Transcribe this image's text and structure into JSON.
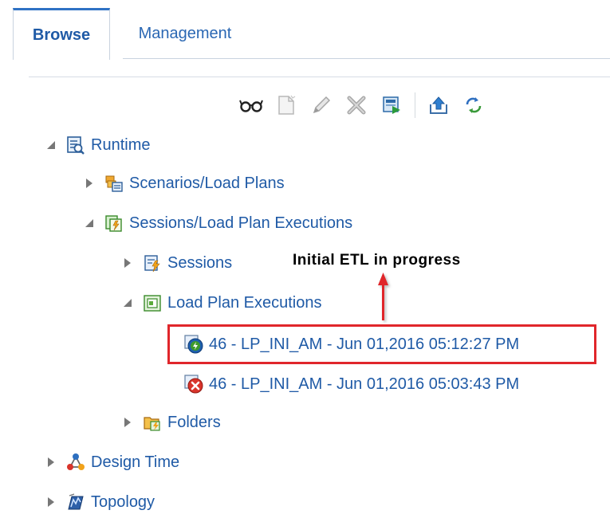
{
  "tabs": {
    "browse": "Browse",
    "management": "Management"
  },
  "toolbar": {
    "icons": [
      "view-icon",
      "new-icon",
      "edit-icon",
      "delete-icon",
      "run-icon",
      "export-icon",
      "refresh-icon"
    ]
  },
  "tree": {
    "runtime": "Runtime",
    "scenarios": "Scenarios/Load Plans",
    "sessions_lpe": "Sessions/Load Plan Executions",
    "sessions": "Sessions",
    "load_plan_executions": "Load Plan Executions",
    "exec_running": "46 - LP_INI_AM - Jun 01,2016 05:12:27 PM",
    "exec_error": "46 - LP_INI_AM - Jun 01,2016 05:03:43 PM",
    "folders": "Folders",
    "design_time": "Design Time",
    "topology": "Topology"
  },
  "annotation": {
    "text": "Initial ETL in progress"
  },
  "colors": {
    "link": "#1f5aa6",
    "highlight": "#e0262b",
    "tab_accent": "#2f72c4"
  }
}
